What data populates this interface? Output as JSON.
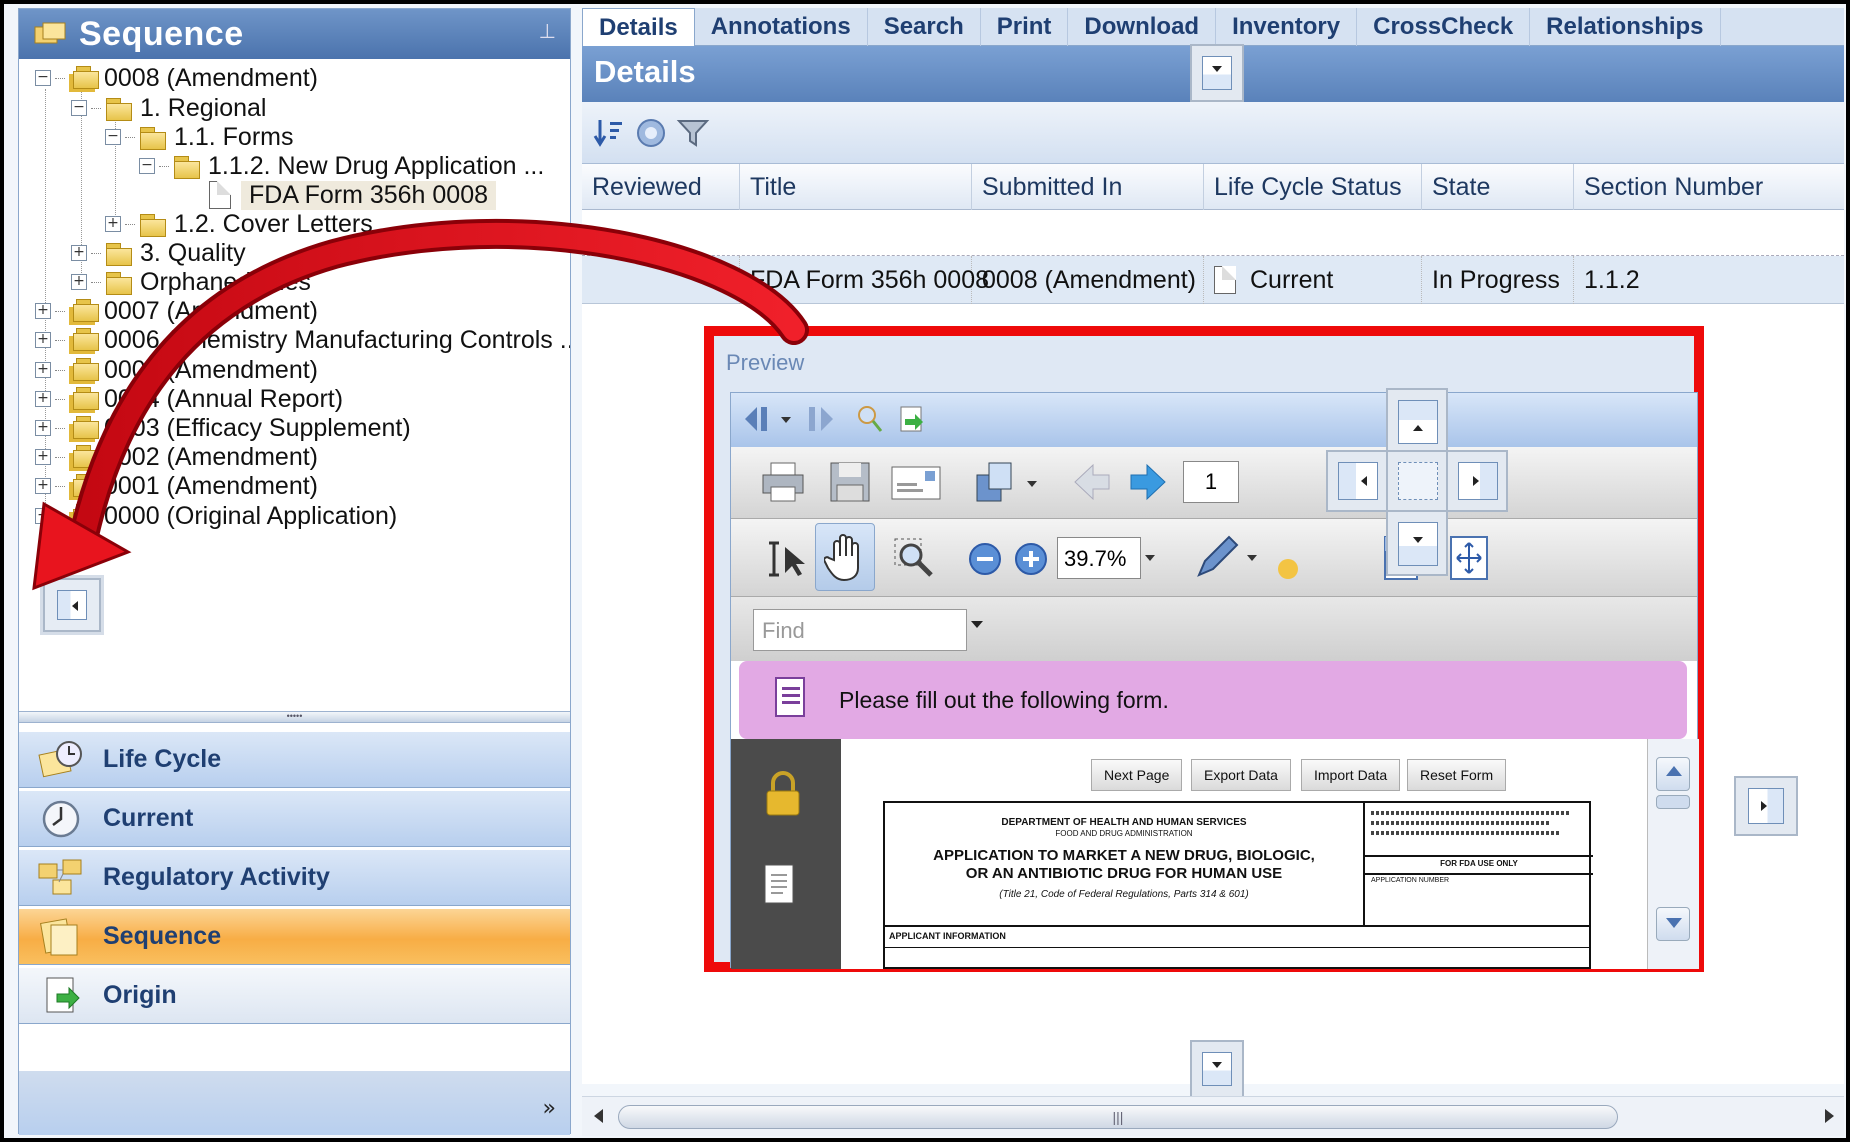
{
  "left_panel": {
    "title": "Sequence",
    "tree": [
      {
        "label": "0008 (Amendment)"
      },
      {
        "label": "1. Regional"
      },
      {
        "label": "1.1. Forms"
      },
      {
        "label": "1.1.2. New Drug Application ..."
      },
      {
        "label": "FDA Form 356h 0008"
      },
      {
        "label": "1.2. Cover Letters"
      },
      {
        "label": "3. Quality"
      },
      {
        "label": "Orphaned Files"
      },
      {
        "label": "0007 (Amendment)"
      },
      {
        "label": "0006 (Chemistry Manufacturing Controls ..."
      },
      {
        "label": "0005 (Amendment)"
      },
      {
        "label": "0004 (Annual Report)"
      },
      {
        "label": "0003 (Efficacy Supplement)"
      },
      {
        "label": "0002 (Amendment)"
      },
      {
        "label": "0001 (Amendment)"
      },
      {
        "label": "0000 (Original Application)"
      }
    ],
    "nav": [
      {
        "label": "Life Cycle",
        "icon": "lifecycle-icon"
      },
      {
        "label": "Current",
        "icon": "clock-icon"
      },
      {
        "label": "Regulatory Activity",
        "icon": "folders-icon"
      },
      {
        "label": "Sequence",
        "icon": "folder-open-icon"
      },
      {
        "label": "Origin",
        "icon": "origin-icon"
      }
    ],
    "overflow": "»"
  },
  "tabs": [
    "Details",
    "Annotations",
    "Search",
    "Print",
    "Download",
    "Inventory",
    "CrossCheck",
    "Relationships"
  ],
  "details_title": "Details",
  "grid": {
    "columns": [
      "Reviewed",
      "Title",
      "Submitted In",
      "Life Cycle Status",
      "State",
      "Section Number"
    ],
    "row": {
      "reviewed": "",
      "title": "FDA Form 356h 0008",
      "submitted_in": "0008 (Amendment)",
      "status": "Current",
      "state": "In Progress",
      "section": "1.1.2"
    }
  },
  "preview": {
    "title": "Preview",
    "page_number": "1",
    "zoom": "39.7%",
    "find_placeholder": "Find",
    "banner": "Please fill out the following form.",
    "form_buttons": [
      "Next Page",
      "Export Data",
      "Import Data",
      "Reset Form"
    ],
    "form": {
      "dept": "DEPARTMENT OF HEALTH AND HUMAN SERVICES",
      "agency": "FOOD AND DRUG ADMINISTRATION",
      "heading1": "APPLICATION TO MARKET A NEW DRUG, BIOLOGIC,",
      "heading2": "OR AN ANTIBIOTIC DRUG FOR HUMAN USE",
      "cite": "(Title 21, Code of Federal Regulations, Parts 314 & 601)",
      "for_fda": "FOR FDA USE ONLY",
      "app_number": "APPLICATION NUMBER",
      "applicant": "APPLICANT INFORMATION"
    }
  },
  "colors": {
    "accent": "#4b73ad",
    "highlight_border": "#ee0a0a",
    "arrow": "#e8141e",
    "active_nav": "#f8ad45",
    "banner": "#e2a9e4"
  }
}
